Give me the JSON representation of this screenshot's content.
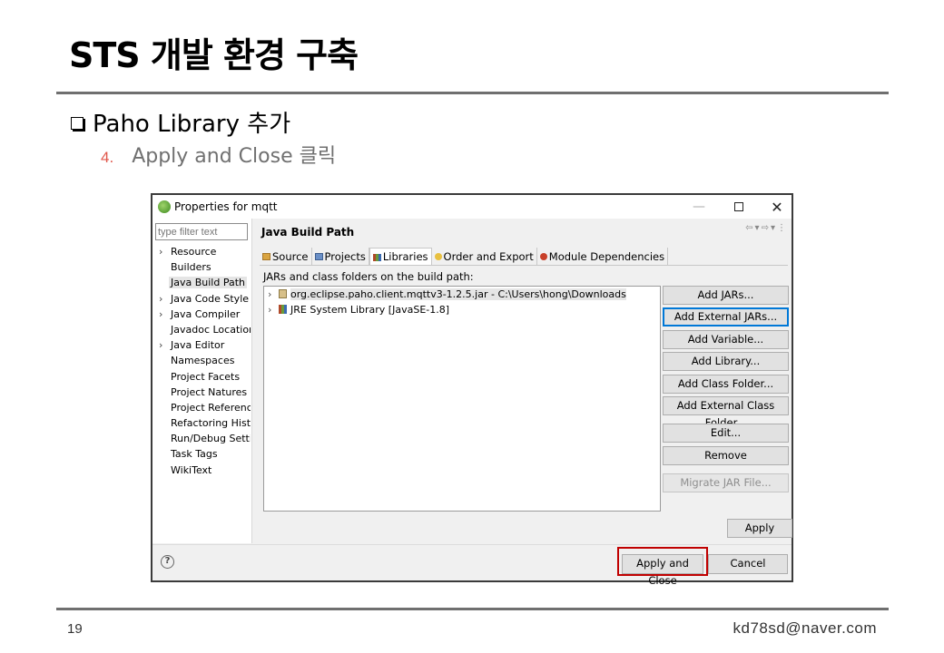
{
  "slide": {
    "title": "STS 개발 환경 구축",
    "bullet": "Paho Library 추가",
    "step_number": "4.",
    "step_text": "Apply and Close 클릭",
    "page_number": "19",
    "author_email": "kd78sd@naver.com"
  },
  "dialog": {
    "title": "Properties for mqtt",
    "filter_placeholder": "type filter text",
    "tree": [
      {
        "label": "Resource",
        "expandable": true
      },
      {
        "label": "Builders",
        "expandable": false
      },
      {
        "label": "Java Build Path",
        "expandable": false,
        "selected": true
      },
      {
        "label": "Java Code Style",
        "expandable": true
      },
      {
        "label": "Java Compiler",
        "expandable": true
      },
      {
        "label": "Javadoc Location",
        "expandable": false
      },
      {
        "label": "Java Editor",
        "expandable": true
      },
      {
        "label": "Namespaces",
        "expandable": false
      },
      {
        "label": "Project Facets",
        "expandable": false
      },
      {
        "label": "Project Natures",
        "expandable": false
      },
      {
        "label": "Project References",
        "expandable": false
      },
      {
        "label": "Refactoring History",
        "expandable": false
      },
      {
        "label": "Run/Debug Settings",
        "expandable": false
      },
      {
        "label": "Task Tags",
        "expandable": false
      },
      {
        "label": "WikiText",
        "expandable": false
      }
    ],
    "section_title": "Java Build Path",
    "tabs": [
      {
        "label": "Source",
        "icon": "source-icon"
      },
      {
        "label": "Projects",
        "icon": "projects-icon"
      },
      {
        "label": "Libraries",
        "icon": "libraries-icon",
        "active": true
      },
      {
        "label": "Order and Export",
        "icon": "order-icon"
      },
      {
        "label": "Module Dependencies",
        "icon": "module-icon"
      }
    ],
    "jar_label": "JARs and class folders on the build path:",
    "entries": [
      {
        "label": "org.eclipse.paho.client.mqttv3-1.2.5.jar - C:\\Users\\hong\\Downloads",
        "icon": "jar-icon",
        "selected": true
      },
      {
        "label": "JRE System Library [JavaSE-1.8]",
        "icon": "library-icon"
      }
    ],
    "buttons": {
      "add_jars": "Add JARs...",
      "add_external_jars": "Add External JARs...",
      "add_variable": "Add Variable...",
      "add_library": "Add Library...",
      "add_class_folder": "Add Class Folder...",
      "add_external_class_folder": "Add External Class Folder...",
      "edit": "Edit...",
      "remove": "Remove",
      "migrate_jar": "Migrate JAR File...",
      "apply": "Apply",
      "apply_and_close": "Apply and Close",
      "cancel": "Cancel"
    }
  },
  "colors": {
    "highlight": "#c00000",
    "step_number": "#e0584c",
    "focus": "#0078d7"
  }
}
